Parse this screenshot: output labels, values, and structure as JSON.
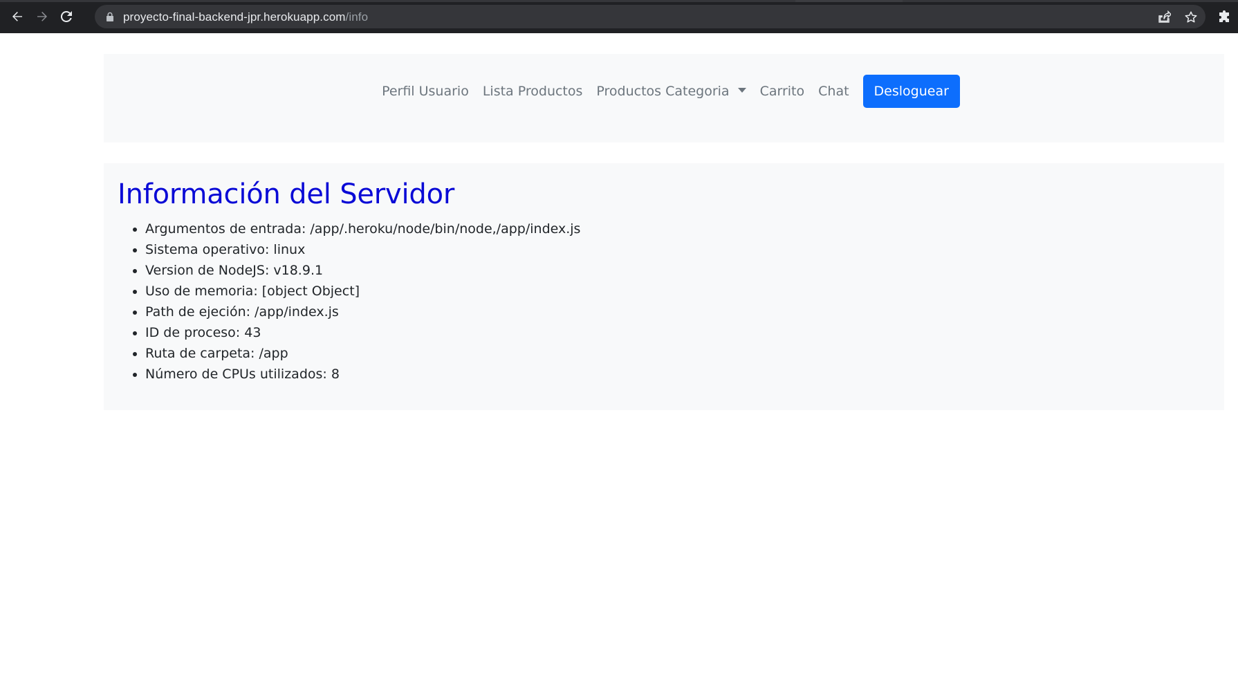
{
  "browser": {
    "url_host": "proyecto-final-backend-jpr.herokuapp.com",
    "url_path": "/info",
    "icons": [
      "back-arrow-icon",
      "forward-arrow-icon",
      "reload-icon",
      "lock-icon",
      "share-icon",
      "star-icon",
      "puzzle-extension-icon"
    ]
  },
  "navbar": {
    "links": {
      "perfil": "Perfil Usuario",
      "lista": "Lista Productos",
      "categoria": "Productos Categoria",
      "carrito": "Carrito",
      "chat": "Chat"
    },
    "logout_label": "Desloguear"
  },
  "info": {
    "title": "Información del Servidor",
    "items": [
      "Argumentos de entrada: /app/.heroku/node/bin/node,/app/index.js",
      "Sistema operativo: linux",
      "Version de NodeJS: v18.9.1",
      "Uso de memoria: [object Object]",
      "Path de ejeción: /app/index.js",
      "ID de proceso: 43",
      "Ruta de carpeta: /app",
      "Número de CPUs utilizados: 8"
    ]
  },
  "colors": {
    "title": "#0a0ad6",
    "primary_button": "#0d6efd",
    "panel_bg": "#f8f9fa",
    "nav_link": "#6c757d",
    "browser_bg": "#202124"
  }
}
